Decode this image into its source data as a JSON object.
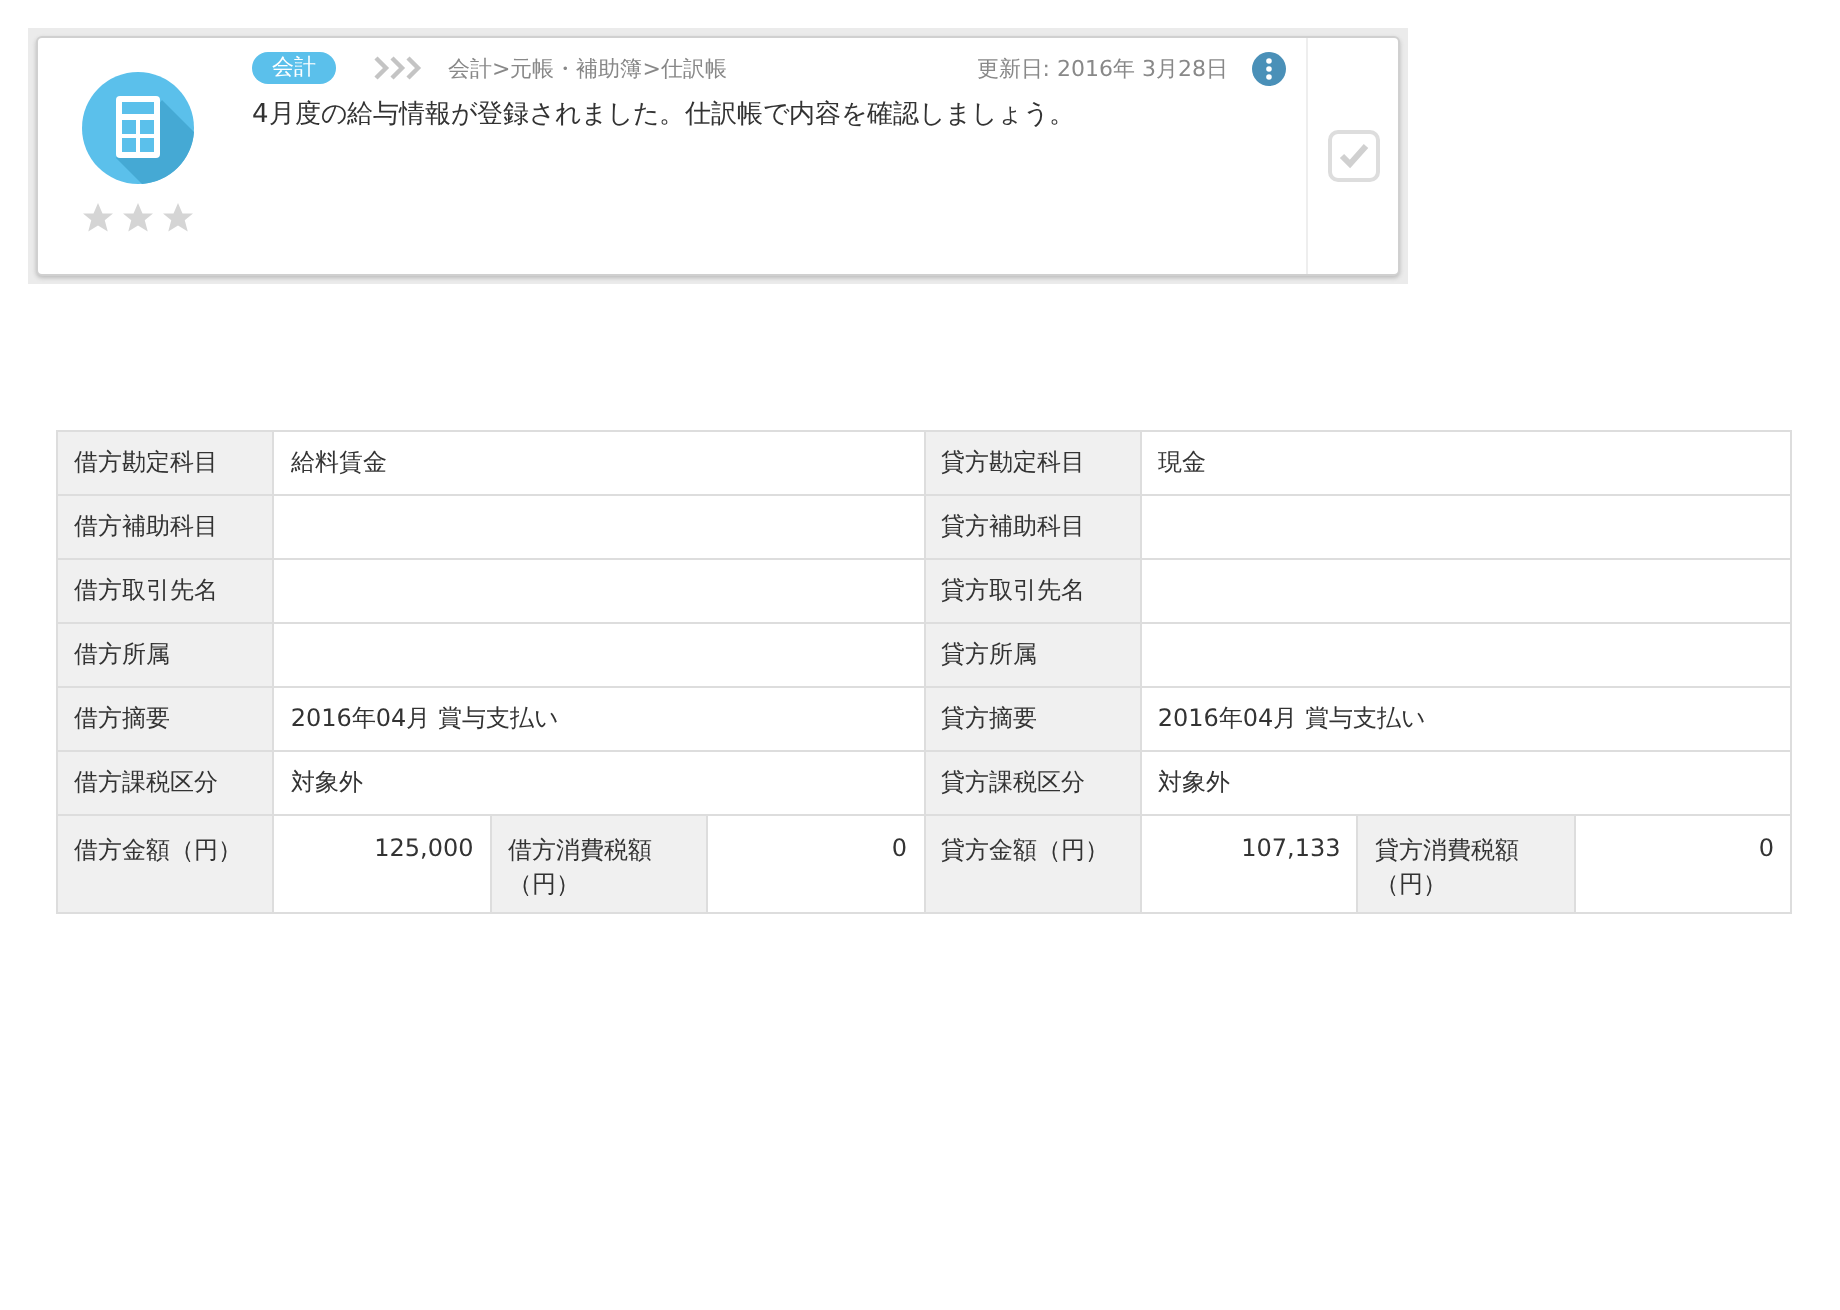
{
  "notice": {
    "tag": "会計",
    "breadcrumb": "会計>元帳・補助簿>仕訳帳",
    "updated": "更新日: 2016年 3月28日",
    "message": "4月度の給与情報が登録されました。仕訳帳で内容を確認しましょう。",
    "stars": 0
  },
  "journal": {
    "rows": [
      {
        "debit_label": "借方勘定科目",
        "debit_value": "給料賃金",
        "credit_label": "貸方勘定科目",
        "credit_value": "現金"
      },
      {
        "debit_label": "借方補助科目",
        "credit_label": "貸方補助科目"
      },
      {
        "debit_label": "借方取引先名",
        "credit_label": "貸方取引先名"
      },
      {
        "debit_label": "借方所属",
        "credit_label": "貸方所属"
      },
      {
        "debit_label": "借方摘要",
        "debit_value": "2016年04月 賞与支払い",
        "credit_label": "貸方摘要",
        "credit_value": "2016年04月 賞与支払い"
      },
      {
        "debit_label": "借方課税区分",
        "debit_value": "対象外",
        "credit_label": "貸方課税区分",
        "credit_value": "対象外"
      }
    ],
    "amounts": {
      "debit_label": "借方金額（円）",
      "debit_value": "125,000",
      "debit_tax_label": "借方消費税額（円）",
      "debit_tax_value": "0",
      "credit_label": "貸方金額（円）",
      "credit_value": "107,133",
      "credit_tax_label": "貸方消費税額（円）",
      "credit_tax_value": "0"
    }
  }
}
